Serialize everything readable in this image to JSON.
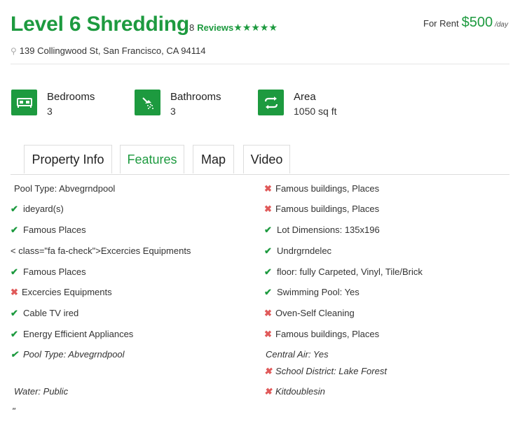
{
  "listing": {
    "title": "Level 6 Shredding",
    "review_count": "8",
    "reviews_label": "Reviews",
    "stars": "★★★★★",
    "price_prefix": "For Rent",
    "price": "$500",
    "price_unit": "/day",
    "address": "139 Collingwood St, San Francisco, CA 94114"
  },
  "stats": [
    {
      "label": "Bedrooms",
      "value": "3",
      "icon": "bed-icon"
    },
    {
      "label": "Bathrooms",
      "value": "3",
      "icon": "shower-icon"
    },
    {
      "label": "Area",
      "value": "1050 sq ft",
      "icon": "area-icon"
    }
  ],
  "tabs": [
    "Property Info",
    "Features",
    "Map",
    "Video"
  ],
  "active_tab": "Features",
  "features_left": [
    {
      "text": "Pool Type: Abvegrndpool",
      "icon": "none"
    },
    {
      "text": "ideyard(s)",
      "icon": "check"
    },
    {
      "text": "Famous Places",
      "icon": "check"
    },
    {
      "text": "< class=\"fa fa-check\">Excercies Equipments",
      "icon": "none"
    },
    {
      "text": "Famous Places",
      "icon": "check"
    },
    {
      "text": "Excercies Equipments",
      "icon": "cross"
    },
    {
      "text": "Cable TV ired",
      "icon": "check"
    },
    {
      "text": "Energy Efficient Appliances",
      "icon": "check"
    },
    {
      "text": "Pool Type: Abvegrndpool",
      "icon": "check"
    },
    {
      "text": "Water: Public",
      "icon": "none"
    },
    {
      "text": "\"",
      "icon": "none"
    }
  ],
  "features_right": [
    {
      "text": "Famous buildings, Places",
      "icon": "cross"
    },
    {
      "text": "Famous buildings, Places",
      "icon": "cross"
    },
    {
      "text": "Lot Dimensions: 135x196",
      "icon": "check"
    },
    {
      "text": "Undrgrndelec",
      "icon": "check"
    },
    {
      "text": "floor: fully Carpeted, Vinyl, Tile/Brick",
      "icon": "check"
    },
    {
      "text": "Swimming Pool: Yes",
      "icon": "check"
    },
    {
      "text": "Oven-Self Cleaning",
      "icon": "cross"
    },
    {
      "text": "Famous buildings, Places",
      "icon": "cross"
    },
    {
      "text": "Central Air: Yes",
      "icon": "none"
    },
    {
      "text": "School District: Lake Forest",
      "icon": "cross"
    },
    {
      "text": "Kitdoublesin",
      "icon": "cross"
    }
  ],
  "colors": {
    "accent": "#1d9a3f",
    "cross": "#e05a5a"
  }
}
